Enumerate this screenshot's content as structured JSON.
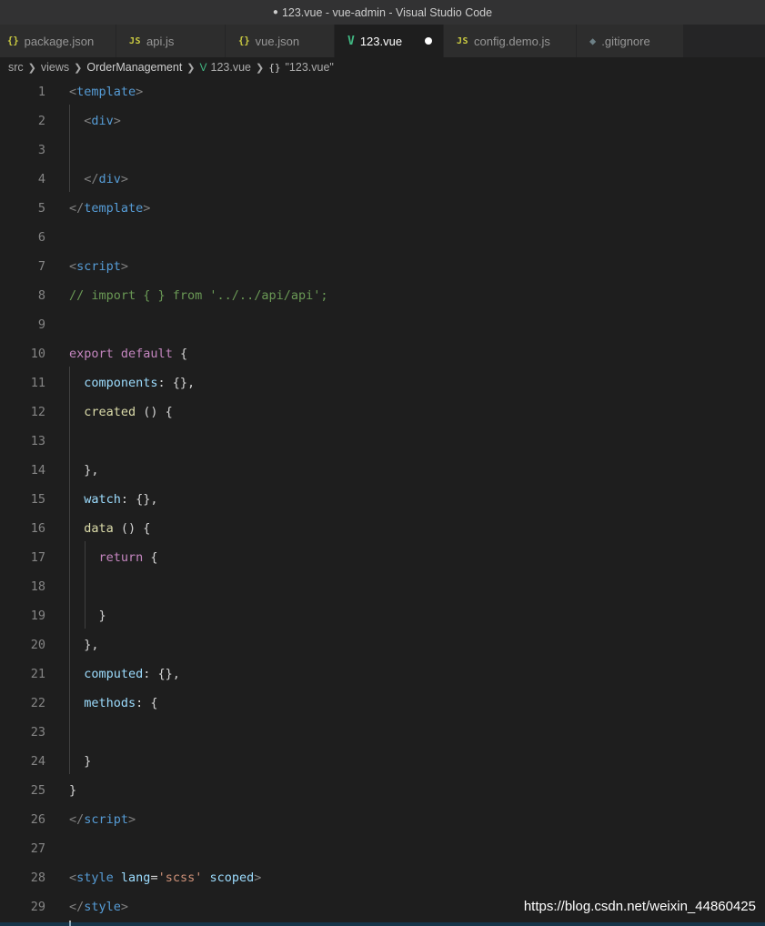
{
  "window": {
    "title": "123.vue - vue-admin - Visual Studio Code",
    "modified_marker": "●"
  },
  "tabs": [
    {
      "icon": "json-file-icon",
      "icon_text": "{}",
      "label": "package.json"
    },
    {
      "icon": "js-file-icon",
      "icon_text": "JS",
      "label": "api.js"
    },
    {
      "icon": "json-file-icon",
      "icon_text": "{}",
      "label": "vue.json"
    },
    {
      "icon": "vue-file-icon",
      "icon_text": "V",
      "label": "123.vue",
      "active": true,
      "modified": true
    },
    {
      "icon": "js-file-icon",
      "icon_text": "JS",
      "label": "config.demo.js"
    },
    {
      "icon": "git-file-icon",
      "icon_text": "◆",
      "label": ".gitignore"
    }
  ],
  "breadcrumb": {
    "items": [
      "src",
      "views",
      "OrderManagement",
      "123.vue",
      "\"123.vue\""
    ],
    "file_icon_text": "V",
    "object_icon_text": "{}"
  },
  "code_lines": [
    {
      "n": "1",
      "tokens": [
        [
          "t-punc",
          "<"
        ],
        [
          "t-tag",
          "template"
        ],
        [
          "t-punc",
          ">"
        ]
      ]
    },
    {
      "n": "2",
      "tokens": [
        [
          "t-plain",
          "  "
        ],
        [
          "t-punc",
          "<"
        ],
        [
          "t-tag",
          "div"
        ],
        [
          "t-punc",
          ">"
        ]
      ]
    },
    {
      "n": "3",
      "tokens": []
    },
    {
      "n": "4",
      "tokens": [
        [
          "t-plain",
          "  "
        ],
        [
          "t-punc",
          "</"
        ],
        [
          "t-tag",
          "div"
        ],
        [
          "t-punc",
          ">"
        ]
      ]
    },
    {
      "n": "5",
      "tokens": [
        [
          "t-punc",
          "</"
        ],
        [
          "t-tag",
          "template"
        ],
        [
          "t-punc",
          ">"
        ]
      ]
    },
    {
      "n": "6",
      "tokens": []
    },
    {
      "n": "7",
      "tokens": [
        [
          "t-punc",
          "<"
        ],
        [
          "t-tag",
          "script"
        ],
        [
          "t-punc",
          ">"
        ]
      ]
    },
    {
      "n": "8",
      "tokens": [
        [
          "t-cmt",
          "// import { } from '../../api/api';"
        ]
      ]
    },
    {
      "n": "9",
      "tokens": []
    },
    {
      "n": "10",
      "tokens": [
        [
          "t-kw",
          "export"
        ],
        [
          "t-plain",
          " "
        ],
        [
          "t-kw",
          "default"
        ],
        [
          "t-plain",
          " {"
        ]
      ]
    },
    {
      "n": "11",
      "tokens": [
        [
          "t-plain",
          "  "
        ],
        [
          "t-prop",
          "components"
        ],
        [
          "t-plain",
          ": {},"
        ]
      ]
    },
    {
      "n": "12",
      "tokens": [
        [
          "t-plain",
          "  "
        ],
        [
          "t-fn",
          "created"
        ],
        [
          "t-plain",
          " () {"
        ]
      ]
    },
    {
      "n": "13",
      "tokens": []
    },
    {
      "n": "14",
      "tokens": [
        [
          "t-plain",
          "  },"
        ]
      ]
    },
    {
      "n": "15",
      "tokens": [
        [
          "t-plain",
          "  "
        ],
        [
          "t-prop",
          "watch"
        ],
        [
          "t-plain",
          ": {},"
        ]
      ]
    },
    {
      "n": "16",
      "tokens": [
        [
          "t-plain",
          "  "
        ],
        [
          "t-fn",
          "data"
        ],
        [
          "t-plain",
          " () {"
        ]
      ]
    },
    {
      "n": "17",
      "tokens": [
        [
          "t-plain",
          "    "
        ],
        [
          "t-kw",
          "return"
        ],
        [
          "t-plain",
          " {"
        ]
      ]
    },
    {
      "n": "18",
      "tokens": []
    },
    {
      "n": "19",
      "tokens": [
        [
          "t-plain",
          "    }"
        ]
      ]
    },
    {
      "n": "20",
      "tokens": [
        [
          "t-plain",
          "  },"
        ]
      ]
    },
    {
      "n": "21",
      "tokens": [
        [
          "t-plain",
          "  "
        ],
        [
          "t-prop",
          "computed"
        ],
        [
          "t-plain",
          ": {},"
        ]
      ]
    },
    {
      "n": "22",
      "tokens": [
        [
          "t-plain",
          "  "
        ],
        [
          "t-prop",
          "methods"
        ],
        [
          "t-plain",
          ": {"
        ]
      ]
    },
    {
      "n": "23",
      "tokens": []
    },
    {
      "n": "24",
      "tokens": [
        [
          "t-plain",
          "  }"
        ]
      ]
    },
    {
      "n": "25",
      "tokens": [
        [
          "t-plain",
          "}"
        ]
      ]
    },
    {
      "n": "26",
      "tokens": [
        [
          "t-punc",
          "</"
        ],
        [
          "t-tag",
          "script"
        ],
        [
          "t-punc",
          ">"
        ]
      ]
    },
    {
      "n": "27",
      "tokens": []
    },
    {
      "n": "28",
      "tokens": [
        [
          "t-punc",
          "<"
        ],
        [
          "t-tag",
          "style"
        ],
        [
          "t-plain",
          " "
        ],
        [
          "t-attr",
          "lang"
        ],
        [
          "t-plain",
          "="
        ],
        [
          "t-str",
          "'scss'"
        ],
        [
          "t-plain",
          " "
        ],
        [
          "t-attr",
          "scoped"
        ],
        [
          "t-punc",
          ">"
        ]
      ]
    },
    {
      "n": "29",
      "tokens": [
        [
          "t-punc",
          "</"
        ],
        [
          "t-tag",
          "style"
        ],
        [
          "t-punc",
          ">"
        ]
      ]
    }
  ],
  "watermark": "https://blog.csdn.net/weixin_44860425"
}
